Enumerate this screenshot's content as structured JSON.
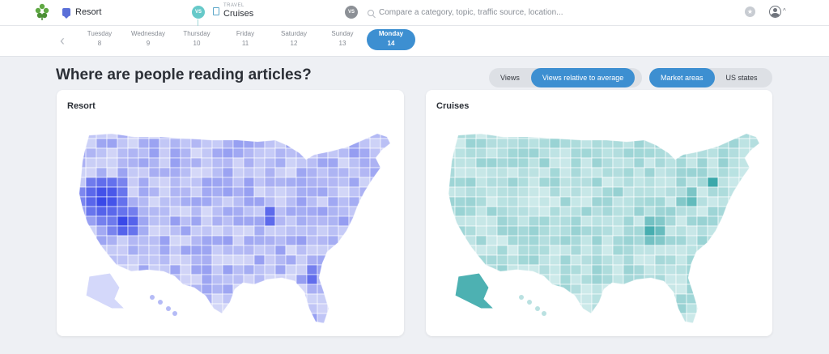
{
  "topbar": {
    "category_1": "Resort",
    "vs_label": "VS",
    "category_2_section": "TRAVEL",
    "category_2": "Cruises",
    "search_placeholder": "Compare a category, topic, traffic source, location..."
  },
  "days": [
    {
      "name": "Tuesday",
      "date": "8"
    },
    {
      "name": "Wednesday",
      "date": "9"
    },
    {
      "name": "Thursday",
      "date": "10"
    },
    {
      "name": "Friday",
      "date": "11"
    },
    {
      "name": "Saturday",
      "date": "12"
    },
    {
      "name": "Sunday",
      "date": "13"
    },
    {
      "name": "Monday",
      "date": "14"
    }
  ],
  "selected_day": "Monday",
  "heading": "Where are people reading articles?",
  "metric_toggle": {
    "options": [
      "Views",
      "Views relative to average"
    ],
    "selected": "Views relative to average"
  },
  "area_toggle": {
    "options": [
      "Market areas",
      "US states"
    ],
    "selected": "Market areas"
  },
  "maps": [
    {
      "title": "Resort",
      "color": "#2a3be6",
      "base": "#e6e8fa"
    },
    {
      "title": "Cruises",
      "color": "#3aa8aa",
      "base": "#dcf1f1"
    }
  ]
}
